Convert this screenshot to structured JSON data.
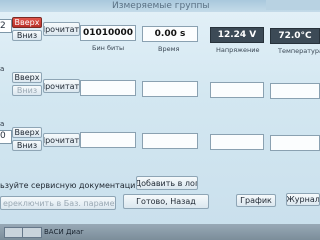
{
  "window": {
    "title": "Измеряемые группы"
  },
  "groups": [
    {
      "edge_number": "2",
      "up_label": "Вверх",
      "down_label": "Вниз",
      "read_label": "Прочитать",
      "values": [
        "01010000",
        "0.00 s",
        "12.24 V",
        "72.0°C"
      ],
      "captions": [
        "Бин биты",
        "Время",
        "Напряжение",
        "Температура"
      ]
    },
    {
      "edge_letter": "а",
      "up_label": "Вверх",
      "down_label": "Вниз",
      "read_label": "Прочитать",
      "values": [
        "",
        "",
        "",
        ""
      ],
      "captions": [
        "",
        "",
        "",
        ""
      ]
    },
    {
      "edge_number": "0",
      "edge_letter": "а",
      "up_label": "Вверх",
      "down_label": "Вниз",
      "read_label": "Прочитать",
      "values": [
        "",
        "",
        "",
        ""
      ],
      "captions": [
        "",
        "",
        "",
        ""
      ]
    }
  ],
  "footer": {
    "notice": "ьзуйте сервисную документацию!",
    "add_log_label": "Добавить в лог",
    "basic_params_label": "ереключить в Баз. параметры",
    "done_back_label": "Готово, Назад",
    "graph_label": "График",
    "journal_label": "Журнал"
  },
  "taskbar": {
    "item_label": "ВАСИ Диаг"
  }
}
